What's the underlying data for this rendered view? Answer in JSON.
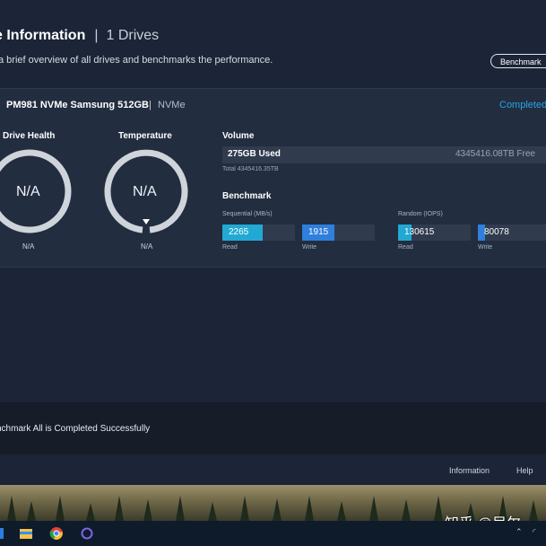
{
  "header": {
    "title": "e Information",
    "separator": "|",
    "drive_count": "1 Drives",
    "subtitle": "a brief overview of all drives and benchmarks the performance.",
    "benchmark_button": "Benchmark"
  },
  "drive": {
    "name": "PM981 NVMe Samsung 512GB",
    "separator": "|",
    "interface": "NVMe",
    "status": "Completed"
  },
  "health": {
    "label": "Drive Health",
    "value": "N/A",
    "sub": "N/A"
  },
  "temperature": {
    "label": "Temperature",
    "value": "N/A",
    "sub": "N/A"
  },
  "volume": {
    "title": "Volume",
    "used": "275GB Used",
    "free": "4345416.08TB Free",
    "total": "Total 4345416.35TB"
  },
  "benchmark": {
    "title": "Benchmark",
    "sequential_label": "Sequential (MB/s)",
    "random_label": "Random (IOPS)",
    "seq_read": {
      "value": "2265",
      "label": "Read",
      "fill": 0.55,
      "color": "#22a9d3"
    },
    "seq_write": {
      "value": "1915",
      "label": "Write",
      "fill": 0.45,
      "color": "#2f7fdc"
    },
    "rand_read": {
      "value": "130615",
      "label": "Read",
      "fill": 0.18,
      "color": "#22a9d3"
    },
    "rand_write": {
      "value": "80078",
      "label": "Write",
      "fill": 0.11,
      "color": "#2f7fdc"
    }
  },
  "footer": {
    "status_text": "nchmark All is Completed Successfully",
    "information_link": "Information",
    "help_link": "Help"
  },
  "watermark": "知乎 @尼尔",
  "taskbar": {
    "icons": [
      "file-explorer-icon",
      "chrome-icon",
      "cortana-icon"
    ]
  },
  "colors": {
    "accent": "#2aa3e8",
    "background": "#1c2537",
    "card": "#222d40"
  }
}
